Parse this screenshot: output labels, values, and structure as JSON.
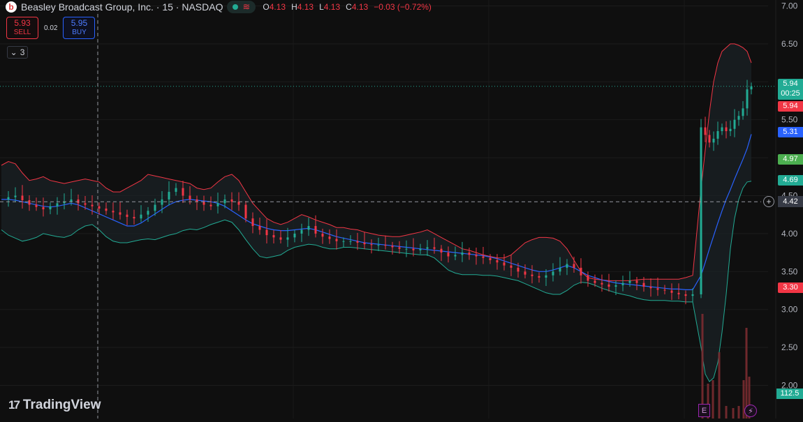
{
  "header": {
    "title": "Beasley Broadcast Group, Inc. · 15 · NASDAQ",
    "logo_letter": "b",
    "status_icon": "wave-icon",
    "ohlc": {
      "o_label": "O",
      "o": "4.13",
      "h_label": "H",
      "h": "4.13",
      "l_label": "L",
      "l": "4.13",
      "c_label": "C",
      "c": "4.13",
      "change": "−0.03 (−0.72%)"
    }
  },
  "trade": {
    "sell_price": "5.93",
    "sell_label": "SELL",
    "spread": "0.02",
    "buy_price": "5.95",
    "buy_label": "BUY"
  },
  "indicators_toggle": {
    "count": "3"
  },
  "branding": {
    "name": "TradingView"
  },
  "price_labels": {
    "last_price": "5.94",
    "countdown": "00:25",
    "red": "5.94",
    "blue": "5.31",
    "green": "4.97",
    "teal": "4.69",
    "crosshair": "4.42",
    "low_red": "3.30",
    "volume": "112.5"
  },
  "markers": {
    "earnings": "E",
    "dividends_icon": "lightning-icon"
  },
  "colors": {
    "up": "#22ab94",
    "down": "#f23645",
    "basis": "#2962ff",
    "upper_band": "#f23645",
    "lower_band": "#22ab94",
    "background": "#0f0f0f"
  },
  "chart_data": {
    "type": "candlestick",
    "y_ticks": [
      "7.00",
      "6.50",
      "6.00",
      "5.50",
      "5.00",
      "4.50",
      "4.00",
      "3.50",
      "3.00",
      "2.50",
      "2.00"
    ],
    "ylim": [
      1.95,
      7.05
    ],
    "grid": true,
    "series": [
      {
        "name": "price",
        "values": [
          4.45,
          4.48,
          4.5,
          4.44,
          4.38,
          4.35,
          4.32,
          4.36,
          4.4,
          4.42,
          4.45,
          4.4,
          4.38,
          4.36,
          4.33,
          4.3,
          4.28,
          4.25,
          4.22,
          4.2,
          4.25,
          4.3,
          4.38,
          4.45,
          4.55,
          4.6,
          4.5,
          4.45,
          4.42,
          4.38,
          4.36,
          4.4,
          4.45,
          4.42,
          4.38,
          4.2,
          4.1,
          4.05,
          3.98,
          3.95,
          3.92,
          3.95,
          4.0,
          4.05,
          4.1,
          4.0,
          3.96,
          3.93,
          3.9,
          3.9,
          3.9,
          3.88,
          3.86,
          3.85,
          3.85,
          3.84,
          3.82,
          3.8,
          3.8,
          3.78,
          3.8,
          3.82,
          3.8,
          3.75,
          3.7,
          3.72,
          3.75,
          3.72,
          3.7,
          3.68,
          3.65,
          3.62,
          3.58,
          3.55,
          3.5,
          3.46,
          3.44,
          3.42,
          3.45,
          3.5,
          3.55,
          3.6,
          3.55,
          3.45,
          3.38,
          3.35,
          3.33,
          3.3,
          3.32,
          3.35,
          3.38,
          3.35,
          3.3,
          3.28,
          3.26,
          3.25,
          3.22,
          3.2,
          3.18,
          3.2,
          5.4,
          5.3,
          5.2,
          5.25,
          5.35,
          5.4,
          5.35,
          5.38,
          5.5,
          5.55,
          5.65,
          5.9,
          5.94
        ]
      },
      {
        "name": "basis",
        "values": [
          4.45,
          4.45,
          4.44,
          4.42,
          4.4,
          4.38,
          4.36,
          4.35,
          4.36,
          4.38,
          4.4,
          4.38,
          4.34,
          4.3,
          4.26,
          4.22,
          4.18,
          4.14,
          4.1,
          4.1,
          4.14,
          4.2,
          4.26,
          4.32,
          4.38,
          4.42,
          4.44,
          4.45,
          4.44,
          4.43,
          4.42,
          4.4,
          4.36,
          4.3,
          4.24,
          4.18,
          4.13,
          4.1,
          4.07,
          4.05,
          4.04,
          4.04,
          4.05,
          4.06,
          4.07,
          4.05,
          4.02,
          3.99,
          3.96,
          3.94,
          3.92,
          3.9,
          3.88,
          3.87,
          3.86,
          3.85,
          3.84,
          3.83,
          3.82,
          3.81,
          3.8,
          3.79,
          3.78,
          3.77,
          3.76,
          3.75,
          3.74,
          3.73,
          3.72,
          3.71,
          3.69,
          3.67,
          3.64,
          3.61,
          3.58,
          3.55,
          3.52,
          3.5,
          3.5,
          3.52,
          3.55,
          3.58,
          3.55,
          3.5,
          3.45,
          3.42,
          3.39,
          3.37,
          3.35,
          3.34,
          3.33,
          3.32,
          3.31,
          3.3,
          3.29,
          3.28,
          3.27,
          3.27,
          3.26,
          3.26,
          3.45,
          3.62,
          3.8,
          3.97,
          4.14,
          4.3,
          4.45,
          4.58,
          4.72,
          4.85,
          4.98,
          5.12,
          5.31
        ]
      },
      {
        "name": "upper_band",
        "values": [
          4.9,
          4.95,
          4.92,
          4.8,
          4.7,
          4.72,
          4.75,
          4.7,
          4.68,
          4.66,
          4.68,
          4.7,
          4.72,
          4.7,
          4.68,
          4.6,
          4.55,
          4.55,
          4.6,
          4.65,
          4.7,
          4.78,
          4.76,
          4.74,
          4.72,
          4.7,
          4.68,
          4.66,
          4.6,
          4.58,
          4.6,
          4.68,
          4.75,
          4.78,
          4.7,
          4.55,
          4.4,
          4.3,
          4.2,
          4.15,
          4.12,
          4.15,
          4.2,
          4.25,
          4.22,
          4.18,
          4.15,
          4.12,
          4.08,
          4.08,
          4.06,
          4.05,
          4.02,
          4.0,
          3.98,
          3.97,
          3.96,
          3.96,
          3.98,
          4.0,
          4.02,
          4.05,
          4.0,
          3.95,
          3.9,
          3.85,
          3.8,
          3.78,
          3.75,
          3.72,
          3.7,
          3.68,
          3.68,
          3.72,
          3.8,
          3.88,
          3.92,
          3.95,
          3.95,
          3.94,
          3.9,
          3.8,
          3.65,
          3.5,
          3.42,
          3.4,
          3.39,
          3.38,
          3.38,
          3.38,
          3.38,
          3.39,
          3.4,
          3.4,
          3.4,
          3.4,
          3.4,
          3.4,
          3.42,
          3.45,
          4.6,
          5.1,
          5.6,
          6.0,
          6.25,
          6.4,
          6.45,
          6.5,
          6.5,
          6.48,
          6.45,
          6.4,
          6.25
        ]
      },
      {
        "name": "lower_band",
        "values": [
          4.05,
          3.98,
          3.94,
          3.9,
          3.92,
          3.95,
          4.0,
          3.98,
          3.96,
          3.95,
          3.98,
          4.05,
          4.1,
          4.12,
          4.05,
          3.96,
          3.9,
          3.88,
          3.88,
          3.9,
          3.92,
          3.93,
          3.92,
          3.95,
          3.98,
          4.0,
          4.04,
          4.06,
          4.05,
          4.08,
          4.12,
          4.15,
          4.18,
          4.15,
          4.05,
          3.92,
          3.8,
          3.7,
          3.68,
          3.7,
          3.72,
          3.78,
          3.82,
          3.84,
          3.86,
          3.85,
          3.82,
          3.8,
          3.8,
          3.82,
          3.82,
          3.81,
          3.8,
          3.79,
          3.78,
          3.77,
          3.76,
          3.75,
          3.74,
          3.73,
          3.72,
          3.72,
          3.68,
          3.6,
          3.52,
          3.48,
          3.46,
          3.46,
          3.46,
          3.45,
          3.45,
          3.44,
          3.42,
          3.4,
          3.38,
          3.34,
          3.3,
          3.26,
          3.22,
          3.2,
          3.2,
          3.25,
          3.32,
          3.36,
          3.35,
          3.32,
          3.28,
          3.25,
          3.22,
          3.2,
          3.18,
          3.15,
          3.13,
          3.12,
          3.12,
          3.12,
          3.11,
          3.11,
          3.1,
          3.1,
          2.5,
          2.15,
          2.05,
          2.1,
          2.3,
          2.7,
          3.2,
          3.8,
          4.2,
          4.45,
          4.6,
          4.68,
          4.69
        ]
      }
    ],
    "annotations": [
      {
        "label": "crosshair",
        "y": 4.42
      }
    ]
  }
}
